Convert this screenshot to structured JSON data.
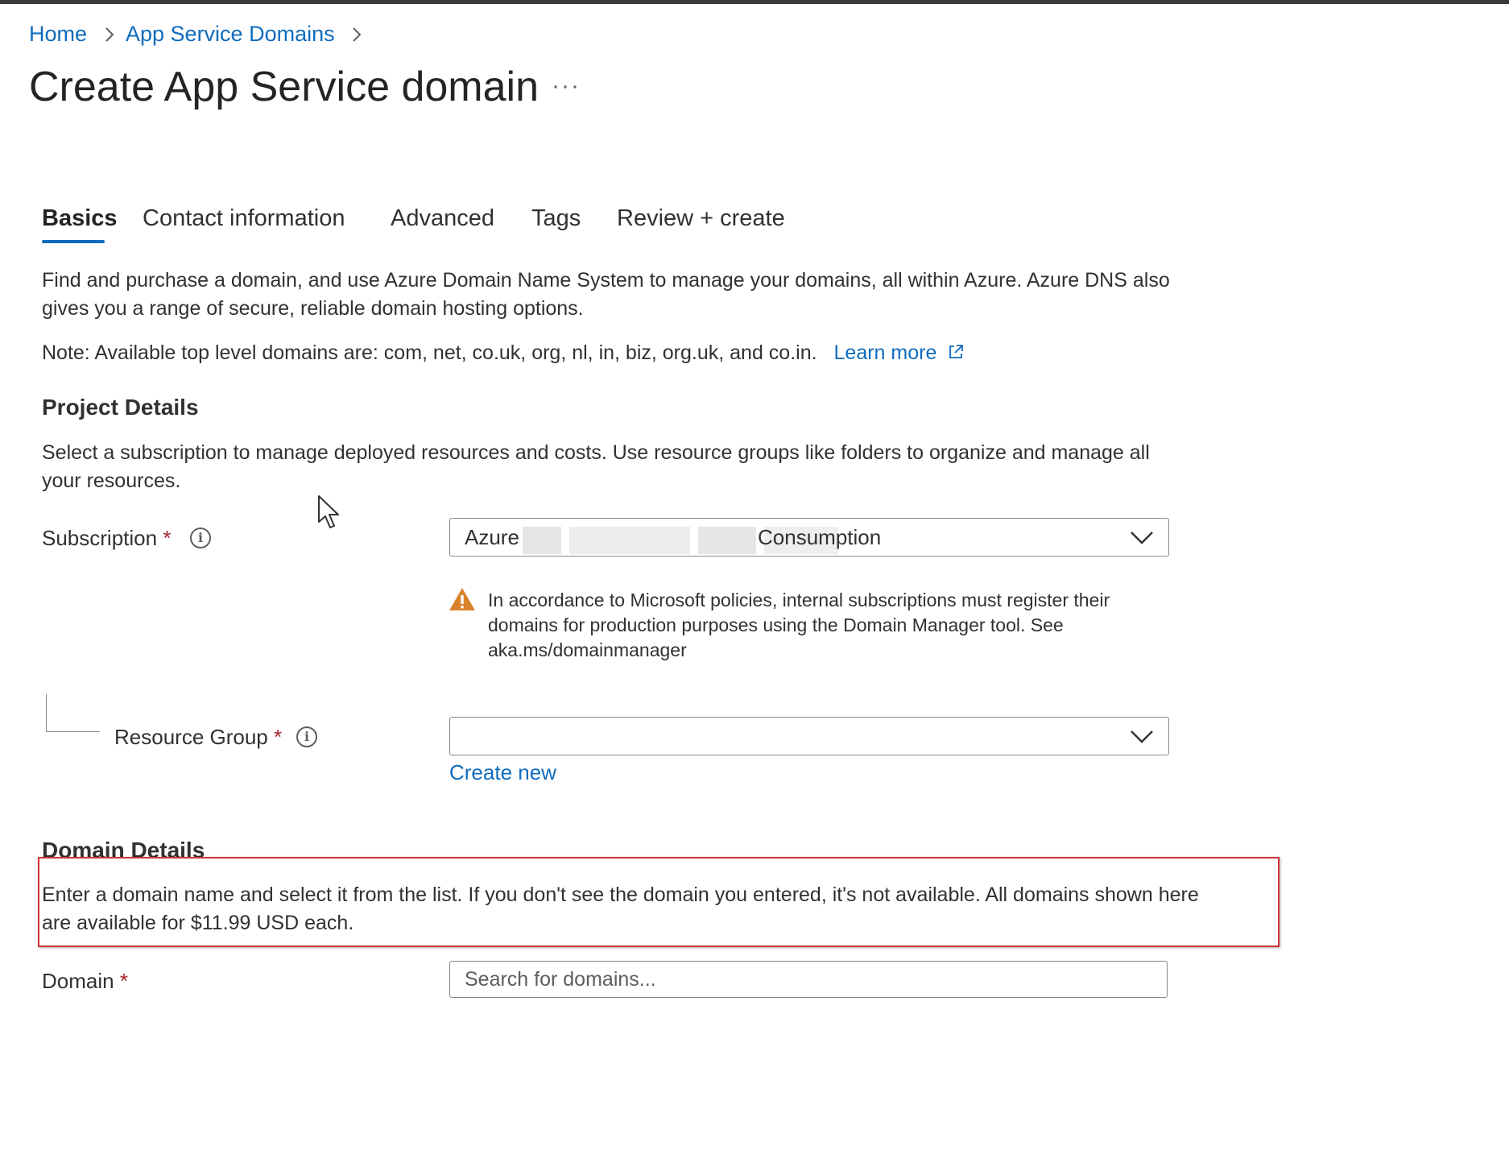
{
  "breadcrumb": {
    "home": "Home",
    "parent": "App Service Domains"
  },
  "page": {
    "title": "Create App Service domain",
    "more": "···"
  },
  "tabs": [
    {
      "label": "Basics",
      "active": true
    },
    {
      "label": "Contact information"
    },
    {
      "label": "Advanced"
    },
    {
      "label": "Tags"
    },
    {
      "label": "Review + create"
    }
  ],
  "intro": {
    "text": "Find and purchase a domain, and use Azure Domain Name System to manage your domains, all within Azure. Azure DNS also gives you a range of secure, reliable domain hosting options.",
    "note": "Note: Available top level domains are: com, net, co.uk, org, nl, in, biz, org.uk, and co.in.",
    "learn_more": "Learn more"
  },
  "project": {
    "title": "Project Details",
    "description": "Select a subscription to manage deployed resources and costs. Use resource groups like folders to organize and manage all your resources.",
    "subscription": {
      "label": "Subscription",
      "required_mark": "*",
      "value_start": "Azure",
      "value_end": "Consumption",
      "warning": "In accordance to Microsoft policies, internal subscriptions must register their domains for production purposes using the Domain Manager tool. See aka.ms/domainmanager"
    },
    "resource_group": {
      "label": "Resource Group",
      "required_mark": "*",
      "value": "",
      "create_new": "Create new"
    }
  },
  "domain_details": {
    "title": "Domain Details",
    "description": "Enter a domain name and select it from the list. If you don't see the domain you entered, it's not available. All domains shown here are available for $11.99 USD each.",
    "domain": {
      "label": "Domain",
      "required_mark": "*",
      "placeholder": "Search for domains...",
      "value": ""
    }
  },
  "colors": {
    "link": "#0f6cbd",
    "required": "#a4262c",
    "warning": "#d9822b",
    "highlight_border": "#d13438",
    "tab_indicator": "#0f6cbd"
  },
  "icons": {
    "breadcrumb_separator": "chevron-right-icon",
    "info": "info-icon",
    "dropdown": "chevron-down-icon",
    "warning": "warning-icon",
    "external_link": "external-link-icon",
    "cursor": "mouse-pointer-icon"
  }
}
